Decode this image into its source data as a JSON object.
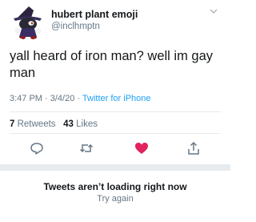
{
  "tweet": {
    "display_name": "hubert plant emoji",
    "handle": "@inclhmptn",
    "text": "yall heard of iron man? well im gay man",
    "time": "3:47 PM",
    "sep1": " · ",
    "date": "3/4/20",
    "sep2": " · ",
    "source": "Twitter for iPhone",
    "retweets_count": "7",
    "retweets_label": "Retweets",
    "likes_count": "43",
    "likes_label": "Likes",
    "liked": true,
    "colors": {
      "like": "#e0245e",
      "link": "#1da1f2",
      "secondary": "#657786"
    }
  },
  "icons": {
    "avatar": "avatar-image",
    "menu": "chevron-down-icon",
    "reply": "reply-icon",
    "retweet": "retweet-icon",
    "like": "heart-icon",
    "share": "share-icon"
  },
  "error": {
    "title": "Tweets aren’t loading right now",
    "retry": "Try again"
  }
}
